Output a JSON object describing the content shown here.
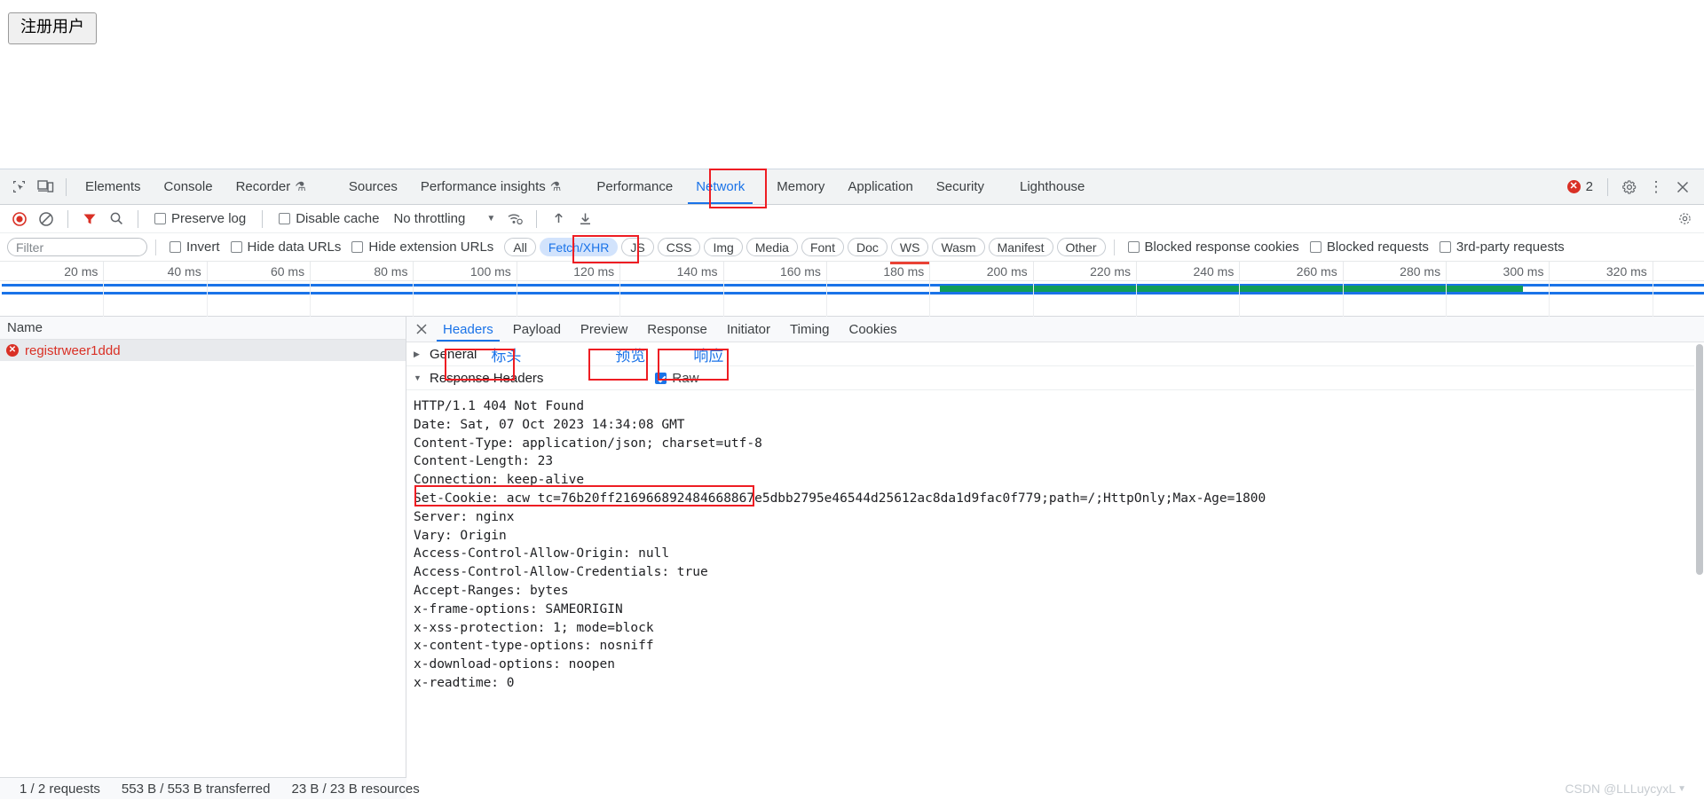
{
  "colors": {
    "accent": "#1a73e8",
    "annotation": "#ee1d23",
    "error": "#d93025",
    "waterfall_green": "#0f9d58",
    "chip_active_bg": "#d2e3fc"
  },
  "site": {
    "register_button": "注册用户"
  },
  "devtools": {
    "inspect_icon": "inspect-element-icon",
    "device_icon": "device-toolbar-icon",
    "tabs": [
      {
        "label": "Elements",
        "active": false,
        "flask": false
      },
      {
        "label": "Console",
        "active": false,
        "flask": false
      },
      {
        "label": "Recorder",
        "active": false,
        "flask": true
      },
      {
        "label": "Sources",
        "active": false,
        "flask": false
      },
      {
        "label": "Performance insights",
        "active": false,
        "flask": true
      },
      {
        "label": "Performance",
        "active": false,
        "flask": false
      },
      {
        "label": "Network",
        "active": true,
        "flask": false
      },
      {
        "label": "Memory",
        "active": false,
        "flask": false
      },
      {
        "label": "Application",
        "active": false,
        "flask": false
      },
      {
        "label": "Security",
        "active": false,
        "flask": false
      },
      {
        "label": "Lighthouse",
        "active": false,
        "flask": false
      }
    ],
    "error_count": "2",
    "settings_icon": "gear-icon",
    "more_icon": "kebab-menu-icon",
    "close_icon": "close-icon"
  },
  "network_controls": {
    "record_icon": "record-button",
    "clear_icon": "clear-icon",
    "filter_icon": "filter-icon",
    "search_icon": "search-icon",
    "preserve_log": {
      "label": "Preserve log",
      "checked": false
    },
    "disable_cache": {
      "label": "Disable cache",
      "checked": false
    },
    "throttling": "No throttling",
    "wifi_icon": "network-conditions-icon",
    "import_icon": "import-har-icon",
    "export_icon": "export-har-icon"
  },
  "filter_bar": {
    "filter_placeholder": "Filter",
    "filter_value": "",
    "invert": {
      "label": "Invert",
      "checked": false
    },
    "hide_data_urls": {
      "label": "Hide data URLs",
      "checked": false
    },
    "hide_extension_urls": {
      "label": "Hide extension URLs",
      "checked": false
    },
    "types": [
      {
        "label": "All",
        "active": false
      },
      {
        "label": "Fetch/XHR",
        "active": true
      },
      {
        "label": "JS",
        "active": false
      },
      {
        "label": "CSS",
        "active": false
      },
      {
        "label": "Img",
        "active": false
      },
      {
        "label": "Media",
        "active": false
      },
      {
        "label": "Font",
        "active": false
      },
      {
        "label": "Doc",
        "active": false
      },
      {
        "label": "WS",
        "active": false
      },
      {
        "label": "Wasm",
        "active": false
      },
      {
        "label": "Manifest",
        "active": false
      },
      {
        "label": "Other",
        "active": false
      }
    ],
    "blocked_response_cookies": {
      "label": "Blocked response cookies",
      "checked": false
    },
    "blocked_requests": {
      "label": "Blocked requests",
      "checked": false
    },
    "third_party_requests": {
      "label": "3rd-party requests",
      "checked": false
    }
  },
  "overview": {
    "ticks": [
      "20 ms",
      "40 ms",
      "60 ms",
      "80 ms",
      "100 ms",
      "120 ms",
      "140 ms",
      "160 ms",
      "180 ms",
      "200 ms",
      "220 ms",
      "240 ms",
      "260 ms",
      "280 ms",
      "300 ms",
      "320 ms"
    ],
    "waterfall_start_ms": 182,
    "waterfall_end_ms": 295,
    "total_ms": 330
  },
  "request_list": {
    "column_header": "Name",
    "rows": [
      {
        "name": "registrweer1ddd",
        "error": true
      }
    ]
  },
  "detail_panel": {
    "close_icon": "close-icon",
    "tabs": [
      {
        "label": "Headers",
        "active": true
      },
      {
        "label": "Payload",
        "active": false
      },
      {
        "label": "Preview",
        "active": false
      },
      {
        "label": "Response",
        "active": false
      },
      {
        "label": "Initiator",
        "active": false
      },
      {
        "label": "Timing",
        "active": false
      },
      {
        "label": "Cookies",
        "active": false
      }
    ],
    "general_section": {
      "label": "General",
      "expanded": false
    },
    "annotations_cn": {
      "headers": "标头",
      "preview": "预览",
      "response": "响应"
    },
    "response_headers_section": {
      "label": "Response Headers",
      "expanded": true
    },
    "raw": {
      "label": "Raw",
      "checked": true
    },
    "header_lines": [
      "HTTP/1.1 404 Not Found",
      "Date: Sat, 07 Oct 2023 14:34:08 GMT",
      "Content-Type: application/json; charset=utf-8",
      "Content-Length: 23",
      "Connection: keep-alive",
      "Set-Cookie: acw_tc=76b20ff216966892484668867e5dbb2795e46544d25612ac8da1d9fac0f779;path=/;HttpOnly;Max-Age=1800",
      "Server: nginx",
      "Vary: Origin",
      "Access-Control-Allow-Origin: null",
      "Access-Control-Allow-Credentials: true",
      "Accept-Ranges: bytes",
      "x-frame-options: SAMEORIGIN",
      "x-xss-protection: 1; mode=block",
      "x-content-type-options: nosniff",
      "x-download-options: noopen",
      "x-readtime: 0"
    ]
  },
  "status_bar": {
    "requests": "1 / 2 requests",
    "transferred": "553 B / 553 B transferred",
    "resources": "23 B / 23 B resources"
  },
  "watermark": "CSDN @LLLuycyxL"
}
